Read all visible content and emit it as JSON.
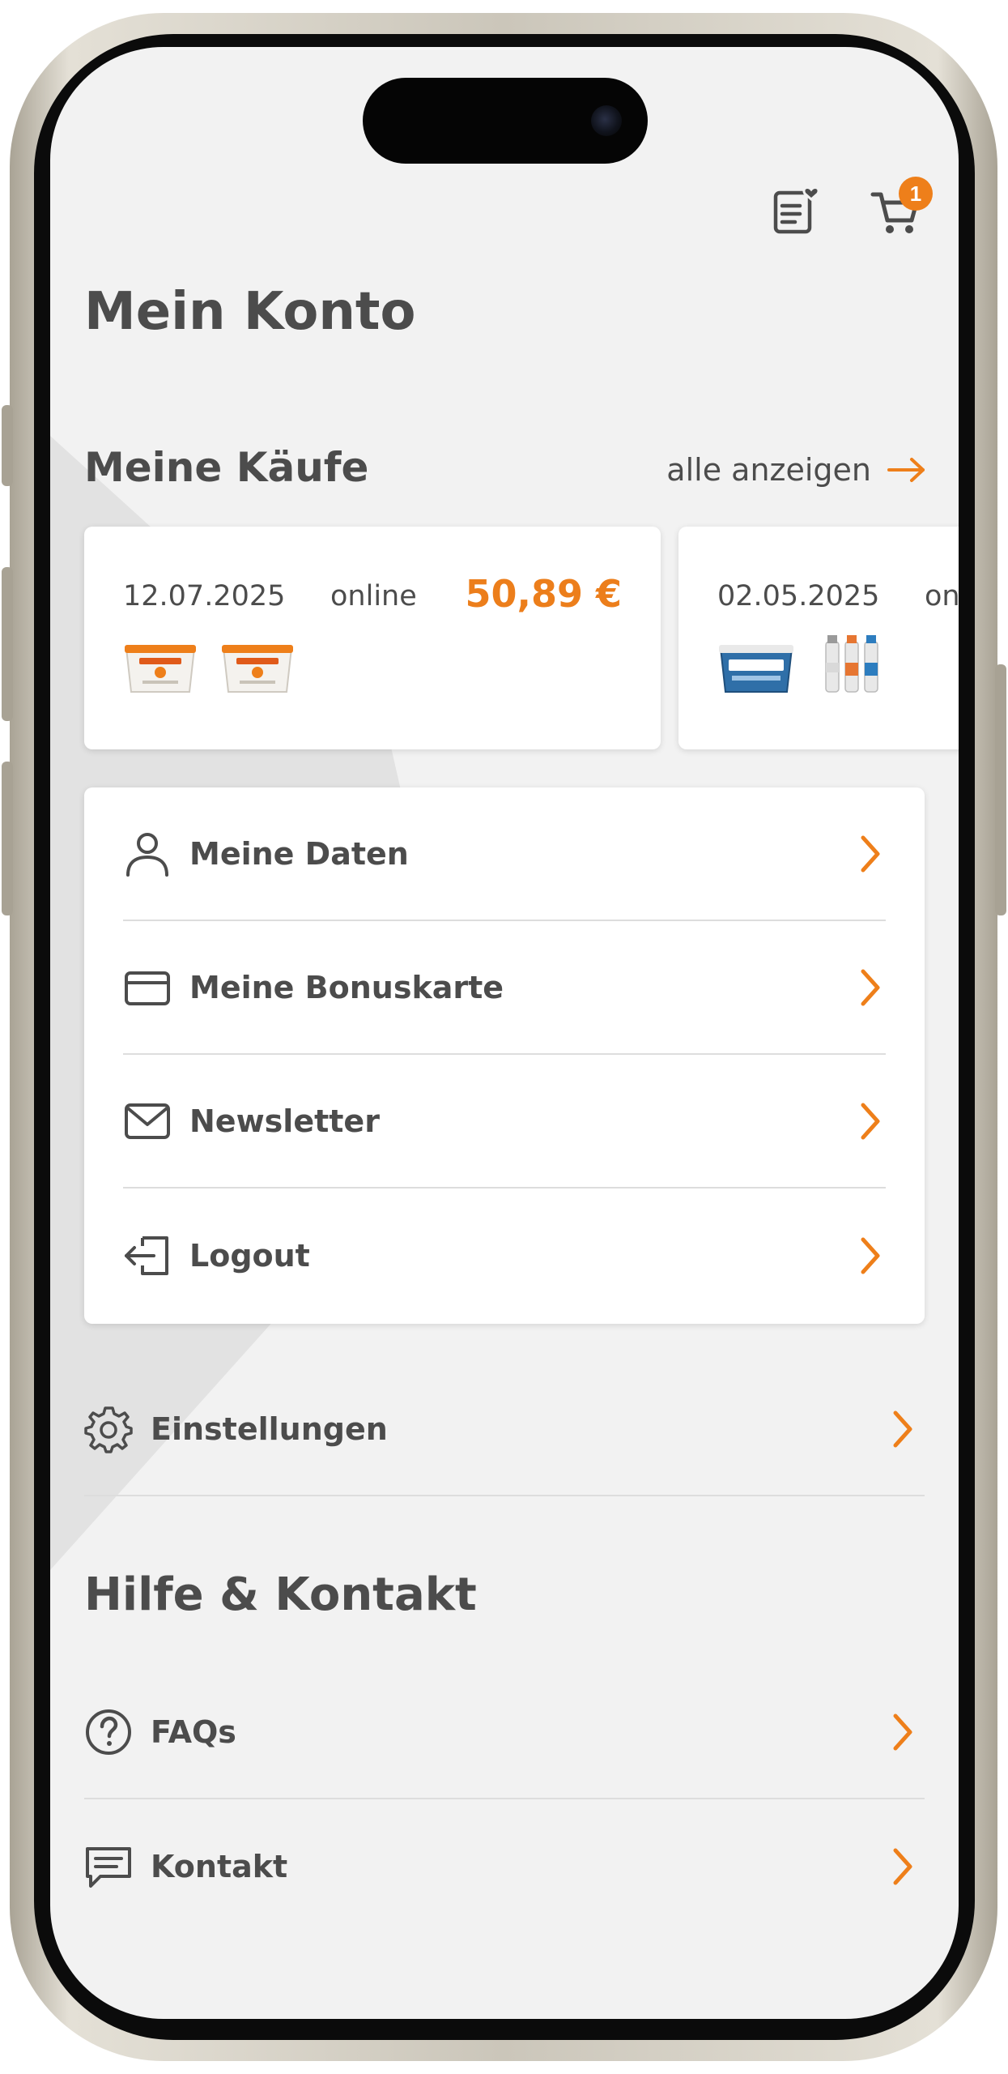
{
  "header": {
    "title": "Mein Konto",
    "cart_count": "1",
    "icons": [
      "wishlist-icon",
      "cart-icon"
    ]
  },
  "purchases": {
    "title": "Meine Käufe",
    "show_all": "alle anzeigen",
    "items": [
      {
        "date": "12.07.2025",
        "channel": "online",
        "price": "50,89 €"
      },
      {
        "date": "02.05.2025",
        "channel": "online",
        "price": ""
      }
    ]
  },
  "account_menu": {
    "items": [
      {
        "label": "Meine Daten",
        "icon": "user-icon"
      },
      {
        "label": "Meine Bonuskarte",
        "icon": "credit-card-icon"
      },
      {
        "label": "Newsletter",
        "icon": "mail-icon"
      },
      {
        "label": "Logout",
        "icon": "logout-icon"
      }
    ]
  },
  "settings": {
    "label": "Einstellungen",
    "icon": "gear-icon"
  },
  "help": {
    "title": "Hilfe & Kontakt",
    "items": [
      {
        "label": "FAQs",
        "icon": "question-circle-icon"
      },
      {
        "label": "Kontakt",
        "icon": "chat-icon"
      }
    ]
  },
  "colors": {
    "accent": "#EE7F1A",
    "text": "#4C4C4C",
    "background": "#F2F2F2",
    "card": "#FFFFFF"
  }
}
